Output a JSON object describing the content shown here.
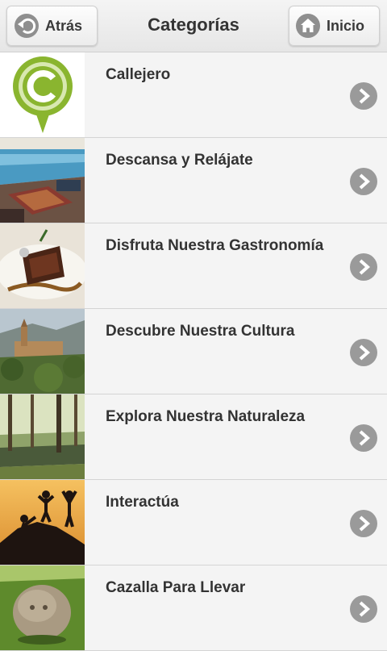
{
  "header": {
    "back_label": "Atrás",
    "title": "Categorías",
    "home_label": "Inicio"
  },
  "categories": [
    {
      "label": "Callejero",
      "image": "callejero-logo"
    },
    {
      "label": "Descansa y Relájate",
      "image": "pool-terrace-photo"
    },
    {
      "label": "Disfruta Nuestra Gastronomía",
      "image": "dish-photo"
    },
    {
      "label": "Descubre Nuestra Cultura",
      "image": "monastery-photo"
    },
    {
      "label": "Explora Nuestra Naturaleza",
      "image": "forest-river-photo"
    },
    {
      "label": "Interactúa",
      "image": "climbers-silhouette-photo"
    },
    {
      "label": "Cazalla Para Llevar",
      "image": "stone-sculpture-photo"
    }
  ],
  "icons": {
    "back": "back-arrow-icon",
    "home": "home-icon",
    "row_arrow": "chevron-right-icon"
  }
}
